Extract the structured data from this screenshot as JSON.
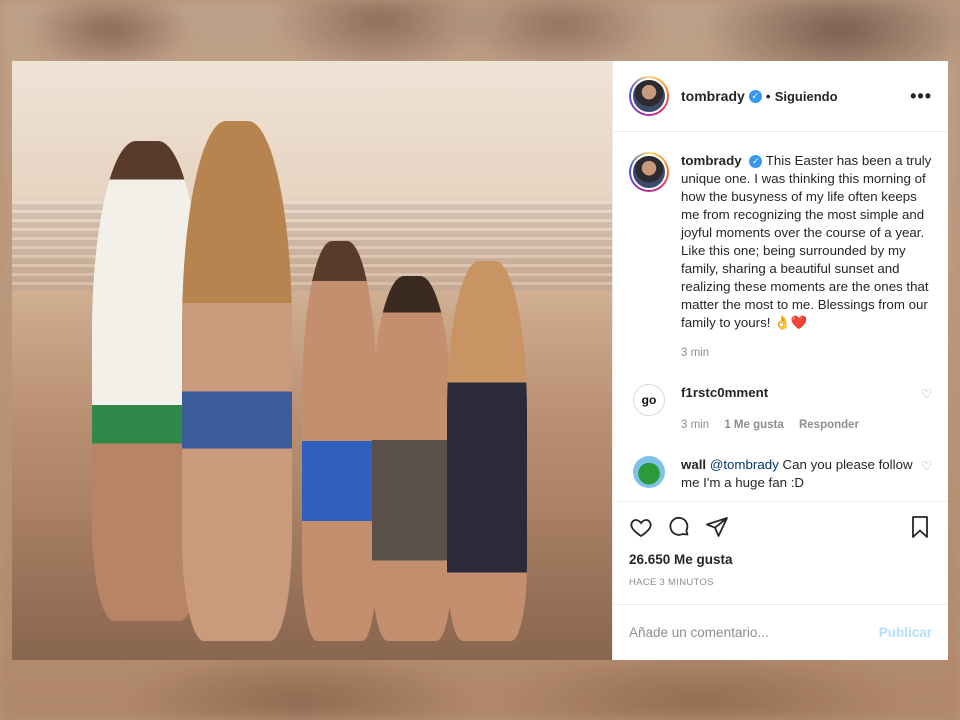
{
  "post": {
    "username": "tombrady",
    "follow_state": "Siguiendo",
    "separator": "•",
    "more_icon": "more-options-icon"
  },
  "caption": {
    "username": "tombrady",
    "text": "This Easter has been a truly unique one. I was thinking this morning of how the busyness of my life often keeps me from recognizing the most simple and joyful moments over the course of a year. Like this one; being surrounded by my family, sharing a beautiful sunset and realizing these moments are the ones that matter the most to me. Blessings from our family to yours! 👌❤️",
    "time": "3 min"
  },
  "comments": [
    {
      "username": "f1rstc0mment",
      "avatar_text": "go",
      "text": "",
      "time": "3 min",
      "likes": "1 Me gusta",
      "reply": "Responder"
    },
    {
      "username": "wall",
      "mention": "@tombrady",
      "text": "Can you please follow me I'm a huge fan :D"
    }
  ],
  "actions": {
    "likes": "26.650 Me gusta",
    "time_ago": "HACE 3 MINUTOS"
  },
  "add_comment": {
    "placeholder": "Añade un comentario...",
    "publish": "Publicar"
  },
  "colors": {
    "verified": "#3897f0",
    "publish_disabled": "#b2dffc"
  }
}
